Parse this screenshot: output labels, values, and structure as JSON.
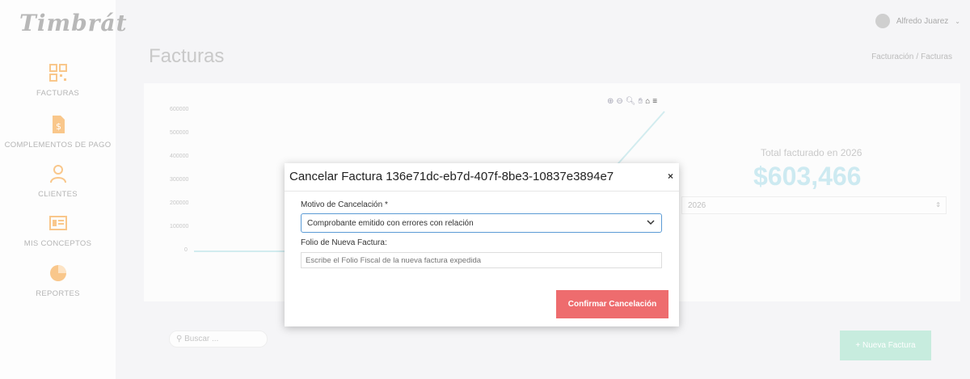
{
  "app": {
    "logo_text": "Timbrát"
  },
  "sidebar": {
    "items": [
      {
        "label": "FACTURAS",
        "icon": "qr-code-icon"
      },
      {
        "label": "COMPLEMENTOS DE PAGO",
        "icon": "dollar-document-icon"
      },
      {
        "label": "CLIENTES",
        "icon": "user-icon"
      },
      {
        "label": "MIS CONCEPTOS",
        "icon": "list-card-icon"
      },
      {
        "label": "REPORTES",
        "icon": "pie-chart-icon"
      }
    ]
  },
  "header": {
    "user_name": "Alfredo Juarez"
  },
  "page": {
    "title": "Facturas",
    "breadcrumb": [
      "Facturación",
      "/",
      "Facturas"
    ]
  },
  "chart": {
    "y_ticks": [
      "600000",
      "500000",
      "400000",
      "300000",
      "200000",
      "100000",
      "0"
    ],
    "total_label": "Total facturado en 2026",
    "total_value": "$603,466",
    "year_value": "2026"
  },
  "chart_data": {
    "type": "line",
    "ylim": [
      0,
      600000
    ],
    "y_ticks": [
      0,
      100000,
      200000,
      300000,
      400000,
      500000,
      600000
    ]
  },
  "table": {
    "search_placeholder": "Buscar ...",
    "new_button": "+ Nueva Factura"
  },
  "modal": {
    "title": "Cancelar Factura 136e71dc-eb7d-407f-8be3-10837e3894e7",
    "close": "×",
    "reason_label": "Motivo de Cancelación *",
    "reason_value": "Comprobante emitido con errores con relación",
    "folio_label": "Folio de Nueva Factura:",
    "folio_placeholder": "Escribe el Folio Fiscal de la nueva factura expedida",
    "confirm_label": "Confirmar Cancelación"
  },
  "colors": {
    "accent": "#ee6c6e",
    "focus": "#5b9bd5",
    "sidebar_icon": "#f9c78b"
  }
}
